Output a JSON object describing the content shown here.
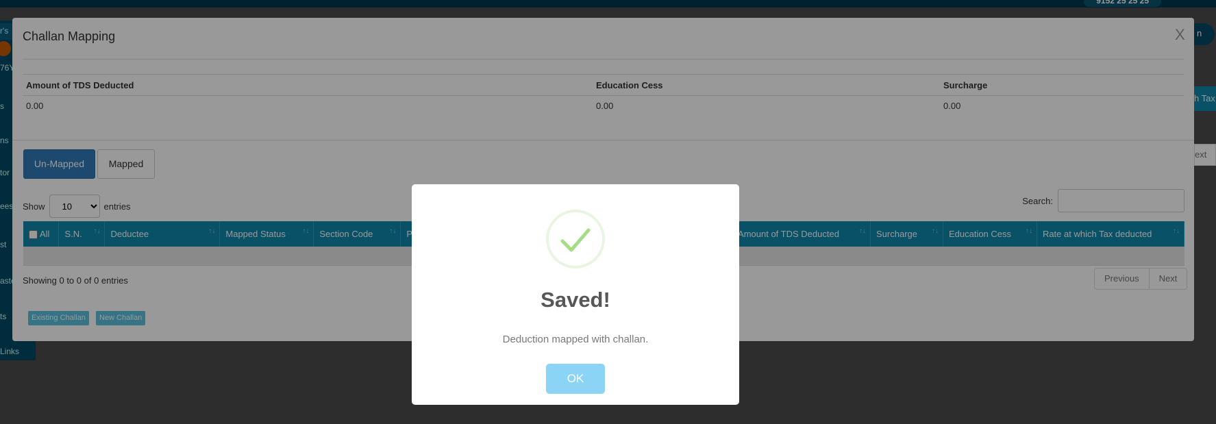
{
  "background": {
    "phone": "9152 25 25 25",
    "sidebar_fragments": [
      "r's",
      "76Y",
      "s",
      "ns",
      "tor",
      "ees",
      "st",
      "aste",
      "ts",
      "Links"
    ],
    "right_fragments": [
      "n",
      "h Tax",
      "ext"
    ]
  },
  "modal": {
    "title": "Challan Mapping",
    "close_label": "X",
    "summary": [
      {
        "label": "Amount of TDS Deducted",
        "value": "0.00"
      },
      {
        "label": "Education Cess",
        "value": "0.00"
      },
      {
        "label": "Surcharge",
        "value": "0.00"
      }
    ],
    "tabs": [
      {
        "label": "Un-Mapped",
        "active": true
      },
      {
        "label": "Mapped",
        "active": false
      }
    ],
    "show_label": "Show",
    "entries_value": "10",
    "entries_label": "entries",
    "search_label": "Search:",
    "search_value": "",
    "columns": [
      "All",
      "S.N.",
      "Deductee",
      "Mapped Status",
      "Section Code",
      "P",
      "Amount of TDS Deducted",
      "Surcharge",
      "Education Cess",
      "Rate at which Tax deducted"
    ],
    "info": "Showing 0 to 0 of 0 entries",
    "pager": {
      "previous": "Previous",
      "next": "Next"
    },
    "buttons": {
      "existing": "Existing Challan",
      "new": "New Challan"
    }
  },
  "alert": {
    "icon": "success-check-icon",
    "title": "Saved!",
    "text": "Deduction mapped with challan.",
    "ok": "OK",
    "check_color": "#a5dc86",
    "ok_color": "#8cd4f5"
  }
}
